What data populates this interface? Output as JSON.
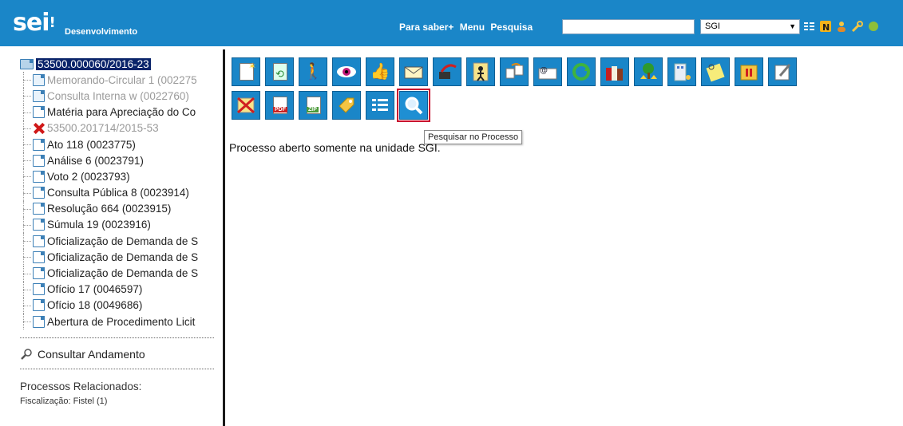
{
  "header": {
    "logo": "sei",
    "environment": "Desenvolvimento",
    "nav": [
      "Para saber+",
      "Menu",
      "Pesquisa"
    ],
    "search_value": "",
    "unit_selected": "SGI",
    "colors": {
      "bar": "#1a86c8",
      "selection": "#0a246a",
      "highlight": "#c8102e"
    }
  },
  "tree": {
    "root": "53500.000060/2016-23",
    "items": [
      {
        "label": "Memorando-Circular 1 (002275",
        "style": "grey"
      },
      {
        "label": "Consulta Interna w (0022760)",
        "style": "grey"
      },
      {
        "label": "Matéria para Apreciação do Co",
        "style": "dark"
      },
      {
        "label": "53500.201714/2015-53",
        "style": "grey",
        "icon": "x"
      },
      {
        "label": "Ato 118 (0023775)",
        "style": "dark"
      },
      {
        "label": "Análise 6 (0023791)",
        "style": "dark"
      },
      {
        "label": "Voto 2 (0023793)",
        "style": "dark"
      },
      {
        "label": "Consulta Pública 8 (0023914)",
        "style": "dark"
      },
      {
        "label": "Resolução 664 (0023915)",
        "style": "dark"
      },
      {
        "label": "Súmula 19 (0023916)",
        "style": "dark"
      },
      {
        "label": "Oficialização de Demanda de S",
        "style": "dark"
      },
      {
        "label": "Oficialização de Demanda de S",
        "style": "dark"
      },
      {
        "label": "Oficialização de Demanda de S",
        "style": "dark"
      },
      {
        "label": "Ofício 17 (0046597)",
        "style": "dark"
      },
      {
        "label": "Ofício 18 (0049686)",
        "style": "dark"
      },
      {
        "label": "Abertura de Procedimento Licit",
        "style": "dark"
      }
    ],
    "consultar_andamento": "Consultar Andamento",
    "relacionados_title": "Processos Relacionados:",
    "relacionados_item": "Fiscalização: Fistel (1)"
  },
  "toolbar": {
    "row1": [
      "new-document-icon",
      "attach-icon",
      "assign-icon",
      "view-icon",
      "approve-icon",
      "send-mail-icon",
      "send-process-icon",
      "user-icon",
      "move-icon",
      "email-icon",
      "refresh-icon",
      "books-icon",
      "tree-icon",
      "building-icon",
      "note-icon",
      "pause-icon",
      "edit-icon"
    ],
    "row2": [
      "cancel-icon",
      "pdf-icon",
      "zip-icon",
      "tag-icon",
      "list-icon",
      "search-process-icon"
    ],
    "pdf_label": "PDF",
    "zip_label": "ZIP",
    "tooltip": "Pesquisar no Processo"
  },
  "status_message": "Processo aberto somente na unidade SGI."
}
